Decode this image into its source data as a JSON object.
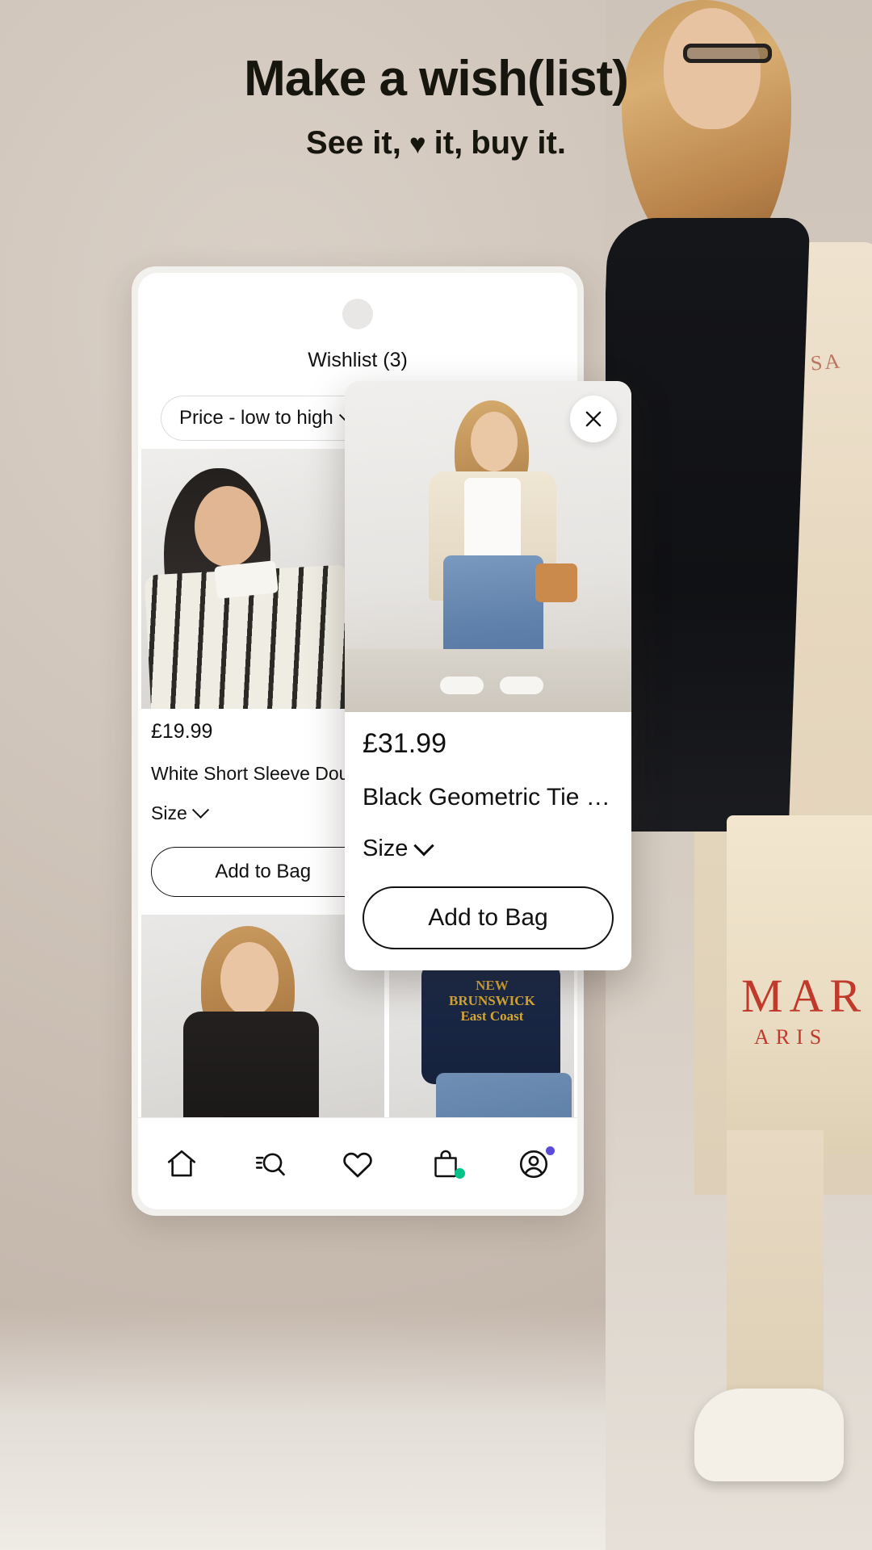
{
  "hero": {
    "headline": "Make a wish(list)",
    "subline_before": "See it,",
    "subline_heart": "♥",
    "subline_mid": "it,",
    "subline_after": "buy it.",
    "background_color": "#c3b6ac"
  },
  "phone": {
    "app_title": "Wishlist (3)",
    "sort": {
      "label": "Price - low to high",
      "chevron_icon": "chevron-down-icon"
    },
    "products": [
      {
        "price": "£19.99",
        "name": "White Short Sleeve Doub...",
        "size_label": "Size",
        "add_to_bag": "Add to Bag",
        "image_alt": "model in black and cream striped short sleeve shirt"
      },
      {
        "image_alt": "model in blue wide leg cargo jeans and cream trench"
      },
      {
        "image_alt": "model in black blazer with black shoulder bag"
      },
      {
        "image_alt": "model in navy New Brunswick sweatshirt and blue jeans"
      }
    ],
    "nav": [
      {
        "name": "home-icon",
        "label": "Home",
        "badge": null
      },
      {
        "name": "search-icon",
        "label": "Search",
        "badge": null
      },
      {
        "name": "heart-icon",
        "label": "Wishlist",
        "badge": null
      },
      {
        "name": "bag-icon",
        "label": "Bag",
        "badge": "green"
      },
      {
        "name": "account-icon",
        "label": "Account",
        "badge": "blue"
      }
    ],
    "badge_colors": {
      "green": "#00c38a",
      "blue": "#5b4bd6"
    }
  },
  "overlay_card": {
    "close_icon": "close-icon",
    "price": "£31.99",
    "name": "Black Geometric Tie Fro...",
    "size_label": "Size",
    "add_to_bag": "Add to Bag",
    "image_alt": "model in cream trench coat, white top and blue cargo jeans"
  },
  "model_photo": {
    "tote_text_main": "MAR",
    "tote_text_sub": "ARIS",
    "dress_text": "RL\nU\nS\nSA"
  }
}
